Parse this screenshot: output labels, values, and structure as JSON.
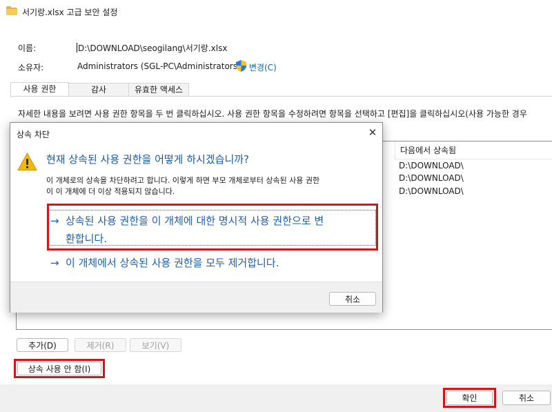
{
  "window": {
    "title": "서기랑.xlsx 고급 보안 설정"
  },
  "fields": {
    "name_label": "이름:",
    "name_value": "D:\\DOWNLOAD\\seogilang\\서기랑.xlsx",
    "owner_label": "소유자:",
    "owner_value": "Administrators (SGL-PC\\Administrators)",
    "change_link": "변경(C)"
  },
  "tabs": [
    {
      "label": "사용 권한",
      "active": true
    },
    {
      "label": "감사",
      "active": false
    },
    {
      "label": "유효한 액세스",
      "active": false
    }
  ],
  "description": "자세한 내용을 보려면 사용 권한 항목을 두 번 클릭하십시오. 사용 권한 항목을 수정하려면 항목을 선택하고 [편집]을 클릭하십시오(사용 가능한 경우",
  "entries": {
    "inherited_header": "다음에서 상속됨",
    "inherited_from": [
      "D:\\DOWNLOAD\\",
      "D:\\DOWNLOAD\\",
      "D:\\DOWNLOAD\\"
    ]
  },
  "buttons": {
    "add": "추가(D)",
    "remove": "제거(R)",
    "view": "보기(V)",
    "disable_inheritance": "상속 사용 안 함(I)",
    "ok": "확인",
    "cancel": "취소"
  },
  "dialog": {
    "title": "상속 차단",
    "close_glyph": "✕",
    "question": "현재 상속된 사용 권한을 어떻게 하시겠습니까?",
    "explanation_line1": "이 개체로의 상속을 차단하려고 합니다. 이렇게 하면 부모 개체로부터 상속된 사용 권한",
    "explanation_line2": "이 이 개체에 더 이상 적용되지 않습니다.",
    "option1_line1": "상속된 사용 권한을 이 개체에 대한 명시적 사용 권한으로 변",
    "option1_line2": "환합니다.",
    "option2": "이 개체에서 상속된 사용 권한을 모두 제거합니다.",
    "arrow_glyph": "→",
    "cancel": "취소"
  },
  "colors": {
    "link": "#0b63b8",
    "command_link": "#1b60b3",
    "highlight": "#d3151a",
    "warning": "#f2b90c"
  },
  "icons": {
    "title": "folder-icon",
    "owner": "uac-shield-icon",
    "dialog": "warning-icon"
  }
}
